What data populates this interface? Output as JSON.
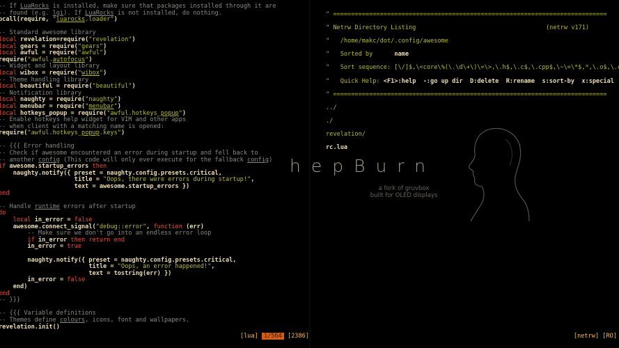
{
  "left_pane": {
    "lines": [
      [
        {
          "t": "-- If ",
          "c": "c"
        },
        {
          "t": "LuaRocks",
          "c": "c u"
        },
        {
          "t": " is installed, make sure that packages installed through it are",
          "c": "c"
        }
      ],
      [
        {
          "t": "-- found (e.g. ",
          "c": "c"
        },
        {
          "t": "lgi",
          "c": "c u"
        },
        {
          "t": "). If ",
          "c": "c"
        },
        {
          "t": "LuaRocks",
          "c": "c u"
        },
        {
          "t": " is not installed, do nothing.",
          "c": "c"
        }
      ],
      [
        {
          "t": "pcall(require, ",
          "c": "w"
        },
        {
          "t": "\"",
          "c": "s"
        },
        {
          "t": "luarocks",
          "c": "s u"
        },
        {
          "t": ".loader\"",
          "c": "s"
        },
        {
          "t": ")",
          "c": "w"
        }
      ],
      [
        {
          "t": "",
          "c": "n"
        }
      ],
      [
        {
          "t": "-- Standard awesome library",
          "c": "c"
        }
      ],
      [
        {
          "t": "local ",
          "c": "k"
        },
        {
          "t": "revelation=require(",
          "c": "w"
        },
        {
          "t": "\"revelation\"",
          "c": "s"
        },
        {
          "t": ")",
          "c": "w"
        }
      ],
      [
        {
          "t": "local ",
          "c": "k"
        },
        {
          "t": "gears = require(",
          "c": "w"
        },
        {
          "t": "\"gears\"",
          "c": "s"
        },
        {
          "t": ")",
          "c": "w"
        }
      ],
      [
        {
          "t": "local ",
          "c": "k"
        },
        {
          "t": "awful = require(",
          "c": "w"
        },
        {
          "t": "\"awful\"",
          "c": "s"
        },
        {
          "t": ")",
          "c": "w"
        }
      ],
      [
        {
          "t": "require(",
          "c": "w"
        },
        {
          "t": "\"awful.",
          "c": "s"
        },
        {
          "t": "autofocus",
          "c": "s u"
        },
        {
          "t": "\"",
          "c": "s"
        },
        {
          "t": ")",
          "c": "w"
        }
      ],
      [
        {
          "t": "-- Widget and layout library",
          "c": "c"
        }
      ],
      [
        {
          "t": "local ",
          "c": "k"
        },
        {
          "t": "wibox = require(",
          "c": "w"
        },
        {
          "t": "\"",
          "c": "s"
        },
        {
          "t": "wibox",
          "c": "s u"
        },
        {
          "t": "\"",
          "c": "s"
        },
        {
          "t": ")",
          "c": "w"
        }
      ],
      [
        {
          "t": "-- Theme handling library",
          "c": "c"
        }
      ],
      [
        {
          "t": "local ",
          "c": "k"
        },
        {
          "t": "beautiful = require(",
          "c": "w"
        },
        {
          "t": "\"beautiful\"",
          "c": "s"
        },
        {
          "t": ")",
          "c": "w"
        }
      ],
      [
        {
          "t": "-- Notification library",
          "c": "c"
        }
      ],
      [
        {
          "t": "local ",
          "c": "k"
        },
        {
          "t": "naughty = require(",
          "c": "w"
        },
        {
          "t": "\"naughty\"",
          "c": "s"
        },
        {
          "t": ")",
          "c": "w"
        }
      ],
      [
        {
          "t": "local ",
          "c": "k"
        },
        {
          "t": "menubar = require(",
          "c": "w"
        },
        {
          "t": "\"",
          "c": "s"
        },
        {
          "t": "menubar",
          "c": "s u"
        },
        {
          "t": "\"",
          "c": "s"
        },
        {
          "t": ")",
          "c": "w"
        }
      ],
      [
        {
          "t": "local ",
          "c": "k"
        },
        {
          "t": "hotkeys_popup = require(",
          "c": "w"
        },
        {
          "t": "\"awful.hotkeys_",
          "c": "s"
        },
        {
          "t": "popup",
          "c": "s u"
        },
        {
          "t": "\"",
          "c": "s"
        },
        {
          "t": ")",
          "c": "w"
        }
      ],
      [
        {
          "t": "-- Enable hotkeys help widget for VIM and other apps",
          "c": "c"
        }
      ],
      [
        {
          "t": "-- when client with a matching name is opened:",
          "c": "c"
        }
      ],
      [
        {
          "t": "require(",
          "c": "w"
        },
        {
          "t": "\"awful.hotkeys_",
          "c": "s"
        },
        {
          "t": "popup",
          "c": "s u"
        },
        {
          "t": ".keys\"",
          "c": "s"
        },
        {
          "t": ")",
          "c": "w"
        }
      ],
      [
        {
          "t": "",
          "c": "n"
        }
      ],
      [
        {
          "t": "-- {{{ Error handling",
          "c": "c"
        }
      ],
      [
        {
          "t": "-- Check if awesome encountered an error during startup and fell back to",
          "c": "c"
        }
      ],
      [
        {
          "t": "-- another ",
          "c": "c"
        },
        {
          "t": "config",
          "c": "c u"
        },
        {
          "t": " (This code will only ever execute for the fallback ",
          "c": "c"
        },
        {
          "t": "config",
          "c": "c u"
        },
        {
          "t": ")",
          "c": "c"
        }
      ],
      [
        {
          "t": "if ",
          "c": "k"
        },
        {
          "t": "awesome.startup_errors ",
          "c": "w"
        },
        {
          "t": "then",
          "c": "k"
        }
      ],
      [
        {
          "t": "    naughty.notify({ preset = naughty.config.presets.critical,",
          "c": "w"
        }
      ],
      [
        {
          "t": "                     title = ",
          "c": "w"
        },
        {
          "t": "\"Oops, there were errors during startup!\"",
          "c": "s"
        },
        {
          "t": ",",
          "c": "w"
        }
      ],
      [
        {
          "t": "                     text = awesome.startup_errors })",
          "c": "w"
        }
      ],
      [
        {
          "t": "end",
          "c": "k"
        }
      ],
      [
        {
          "t": "",
          "c": "n"
        }
      ],
      [
        {
          "t": "-- Handle ",
          "c": "c"
        },
        {
          "t": "runtime",
          "c": "c u"
        },
        {
          "t": " errors after startup",
          "c": "c"
        }
      ],
      [
        {
          "t": "do",
          "c": "k"
        }
      ],
      [
        {
          "t": "    local ",
          "c": "k"
        },
        {
          "t": "in_error = ",
          "c": "w"
        },
        {
          "t": "false",
          "c": "k"
        }
      ],
      [
        {
          "t": "    awesome.connect_signal(",
          "c": "w"
        },
        {
          "t": "\"debug::error\"",
          "c": "s"
        },
        {
          "t": ", ",
          "c": "w"
        },
        {
          "t": "function ",
          "c": "k"
        },
        {
          "t": "(err)",
          "c": "w"
        }
      ],
      [
        {
          "t": "        -- Make sure we don't go into an endless error loop",
          "c": "c"
        }
      ],
      [
        {
          "t": "        if ",
          "c": "k"
        },
        {
          "t": "in_error ",
          "c": "w"
        },
        {
          "t": "then return end",
          "c": "k"
        }
      ],
      [
        {
          "t": "        in_error = ",
          "c": "w"
        },
        {
          "t": "true",
          "c": "k"
        }
      ],
      [
        {
          "t": "",
          "c": "n"
        }
      ],
      [
        {
          "t": "        naughty.notify({ preset = naughty.config.presets.critical,",
          "c": "w"
        }
      ],
      [
        {
          "t": "                         title = ",
          "c": "w"
        },
        {
          "t": "\"Oops, an error happened!\"",
          "c": "s"
        },
        {
          "t": ",",
          "c": "w"
        }
      ],
      [
        {
          "t": "                         text = tostring(err) })",
          "c": "w"
        }
      ],
      [
        {
          "t": "        in_error = ",
          "c": "w"
        },
        {
          "t": "false",
          "c": "k"
        }
      ],
      [
        {
          "t": "    end)",
          "c": "w"
        }
      ],
      [
        {
          "t": "end",
          "c": "k"
        }
      ],
      [
        {
          "t": "-- }}}",
          "c": "c"
        }
      ],
      [
        {
          "t": "",
          "c": "n"
        }
      ],
      [
        {
          "t": "-- {{{ Variable definitions",
          "c": "c"
        }
      ],
      [
        {
          "t": "-- Themes define ",
          "c": "c"
        },
        {
          "t": "colours",
          "c": "c u"
        },
        {
          "t": ", icons, font and wallpapers.",
          "c": "c"
        }
      ],
      [
        {
          "t": "revelation.init()",
          "c": "w"
        }
      ]
    ],
    "status": {
      "filetype": "[lua]",
      "position": "1/564",
      "bytes": "[2386]"
    }
  },
  "right_pane": {
    "netrw": {
      "rule": "\" ============================================================================",
      "title": "\" Netrw Directory Listing",
      "version": "(netrw v171)",
      "path": "\"   /home/makc/dot/.config/awesome",
      "sorted_label": "\"   Sorted by      ",
      "sorted_value": "name",
      "sequence": "\"   Sort sequence: [\\/]$,\\<core\\%(\\.\\d\\+\\)\\=\\>,\\.h$,\\.c$,\\.cpp$,\\~\\=\\*$,*,\\.o$,\\.obj$,\\",
      "quickhelp_label": "\"   Quick Help: ",
      "quickhelp": "<F1>:help  -:go up dir  D:delete  R:rename  s:sort-by  x:special",
      "rule_end": "\" ============================================================================",
      "entries": [
        "../",
        "./",
        "revelation/",
        "rc.lua"
      ]
    },
    "status": "[netrw] [RO]"
  },
  "wallpaper": {
    "title": "hepBurn",
    "subtitle_1": "a fork of gruvbox",
    "subtitle_2": "built for OLED displays"
  },
  "colors": {
    "background": "#000000",
    "comment": "#8a8a80",
    "keyword": "#fb4934",
    "string": "#b8bb26",
    "accent": "#fabd2f",
    "position_bg": "#d65d0e"
  }
}
